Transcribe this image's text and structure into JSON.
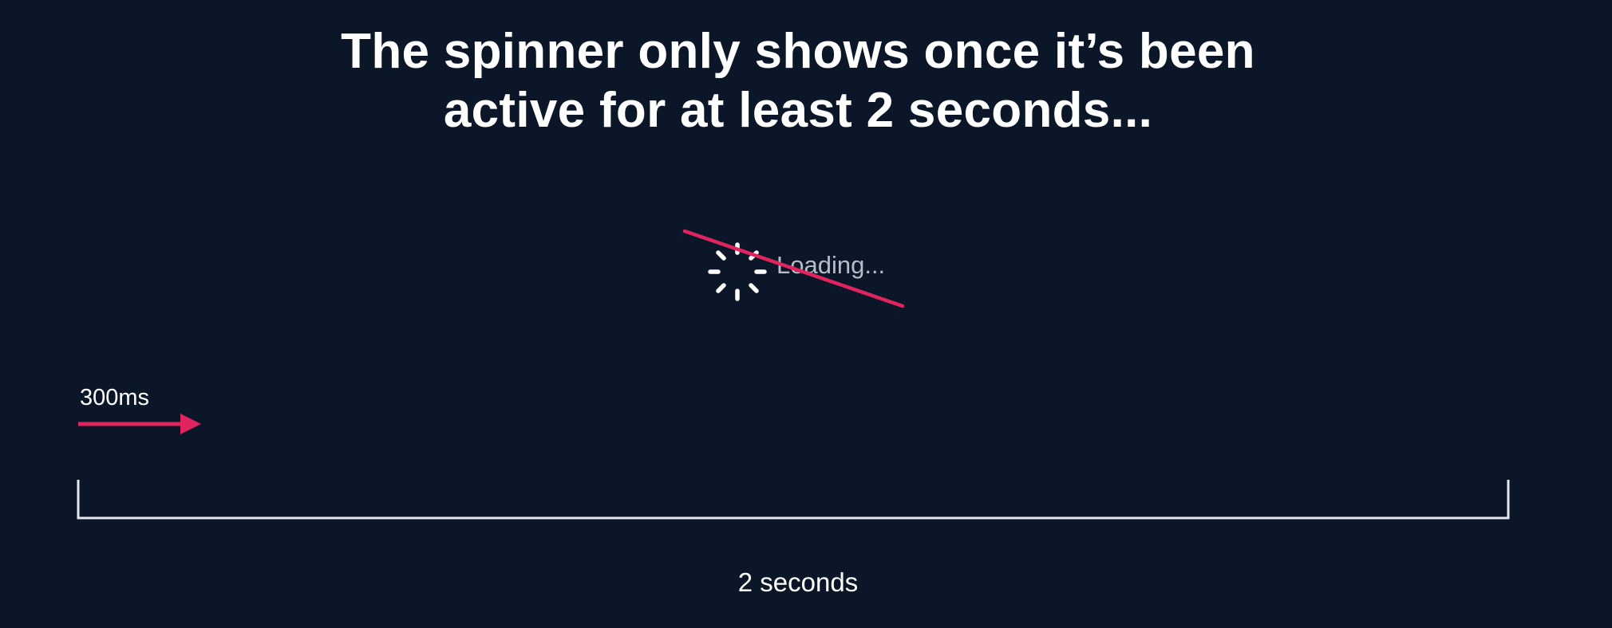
{
  "headline": {
    "line1": "The spinner only shows once it’s been",
    "line2": "active for at least 2 seconds..."
  },
  "spinner": {
    "icon": "spinner-icon",
    "label": "Loading...",
    "crossed_out": true
  },
  "timeline": {
    "delay_label": "300ms",
    "duration_label": "2 seconds"
  },
  "colors": {
    "background": "#0b1628",
    "accent": "#e0245e",
    "text": "#ffffff",
    "muted_text": "#b7bcc6"
  }
}
